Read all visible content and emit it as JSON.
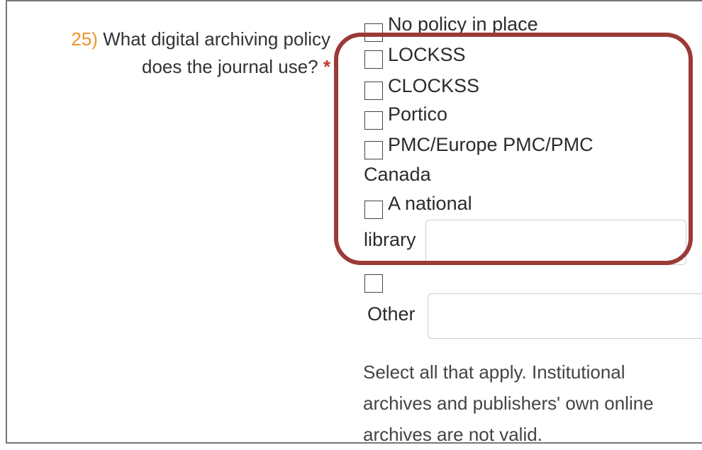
{
  "question": {
    "number": "25)",
    "text_line1": "What digital archiving policy",
    "text_line2": "does the journal use?",
    "required_mark": "*"
  },
  "options": {
    "no_policy": "No policy in place",
    "lockss": "LOCKSS",
    "clockss": "CLOCKSS",
    "portico": "Portico",
    "pmc_line1": "PMC/Europe PMC/PMC",
    "pmc_line2": "Canada",
    "national_line1": "A national",
    "national_line2": "library",
    "other": "Other"
  },
  "help_text": "Select all that apply. Institutional archives and publishers' own online archives are not valid.",
  "colors": {
    "question_number": "#f0932b",
    "required_mark": "#c0392b",
    "highlight_border": "#9b3a37"
  }
}
